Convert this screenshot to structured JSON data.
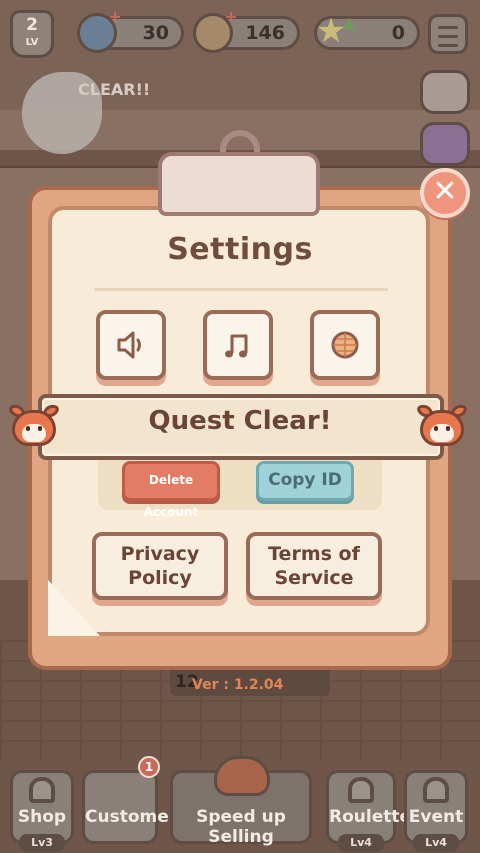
{
  "topbar": {
    "level": "2",
    "level_label": "LV",
    "gems": "30",
    "coins": "146",
    "stars": "0",
    "clear_tag": "CLEAR!!"
  },
  "settings": {
    "title": "Settings",
    "delete_account": "Delete Account",
    "copy_id": "Copy ID",
    "privacy_policy": "Privacy\nPolicy",
    "terms_of_service": "Terms of\nService",
    "version_prefix": "12",
    "version": "Ver : 1.2.04"
  },
  "banner": {
    "text": "Quest Clear!"
  },
  "bottom_nav": {
    "shop": "Shop",
    "shop_level": "Lv3",
    "customer": "Customer",
    "customer_badge": "1",
    "speed_up": "Speed up Selling",
    "roulette": "Roulette",
    "roulette_level": "Lv4",
    "event": "Event",
    "event_level": "Lv4"
  },
  "colors": {
    "board": "#e0a682",
    "paper": "#f8ecd8",
    "close": "#f0957d",
    "delete": "#e27c64",
    "copy": "#9fd2d8",
    "text_brown": "#6a4435"
  },
  "icons": [
    "speaker-icon",
    "music-note-icon",
    "globe-icon",
    "close-icon",
    "red-panda-icon",
    "lock-icon",
    "gem-icon",
    "coin-icon",
    "star-icon",
    "menu-icon"
  ]
}
